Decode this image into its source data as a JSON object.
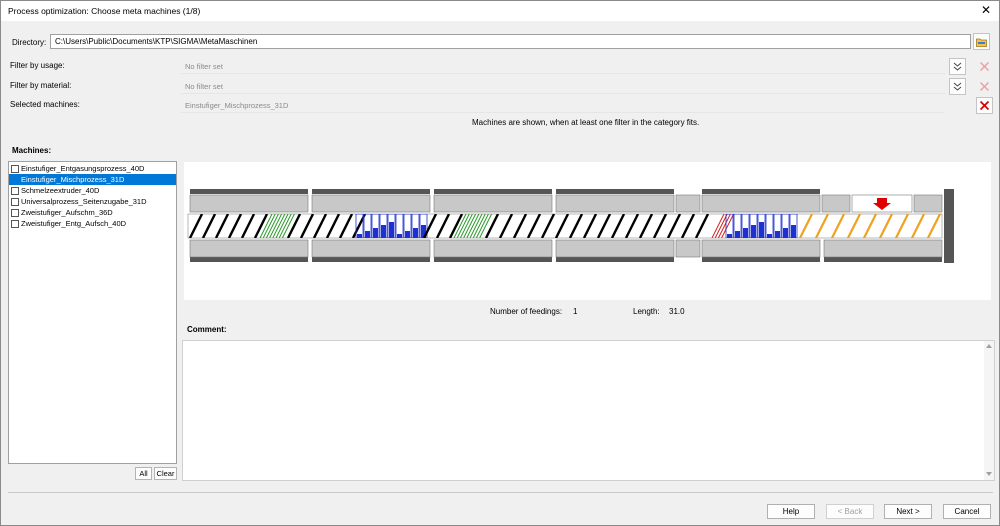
{
  "window": {
    "title": "Process optimization: Choose meta machines (1/8)"
  },
  "directory": {
    "label": "Directory:",
    "value": "C:\\Users\\Public\\Documents\\KTP\\SIGMA\\MetaMaschinen"
  },
  "filters": {
    "usage_label": "Filter by usage:",
    "usage_value": "No filter set",
    "material_label": "Filter by material:",
    "material_value": "No filter set",
    "selected_label": "Selected machines:",
    "selected_value": "Einstufiger_Mischprozess_31D",
    "info": "Machines are shown, when at least one filter in the category fits."
  },
  "machines": {
    "header": "Machines:",
    "items": [
      {
        "label": "Einstufiger_Entgasungsprozess_40D",
        "selected": false
      },
      {
        "label": "Einstufiger_Mischprozess_31D",
        "selected": true
      },
      {
        "label": "Schmelzeextruder_40D",
        "selected": false
      },
      {
        "label": "Universalprozess_Seitenzugabe_31D",
        "selected": false
      },
      {
        "label": "Zweistufiger_Aufschm_36D",
        "selected": false
      },
      {
        "label": "Zweistufiger_Entg_Aufsch_40D",
        "selected": false
      }
    ],
    "all_label": "All",
    "clear_label": "Clear"
  },
  "stats": {
    "feedings_label": "Number of feedings:",
    "feedings_value": "1",
    "length_label": "Length:",
    "length_value": "31.0"
  },
  "comment": {
    "label": "Comment:"
  },
  "buttons": {
    "help": "Help",
    "back": "< Back",
    "next": "Next >",
    "cancel": "Cancel"
  },
  "colors": {
    "selection": "#0078d7",
    "remove_icon": "#d00000",
    "feed_arrow": "#e00000",
    "mixing_green": "#2a9a2a",
    "kneading_blue": "#1f2fd0",
    "conveying_orange": "#f0a020"
  }
}
